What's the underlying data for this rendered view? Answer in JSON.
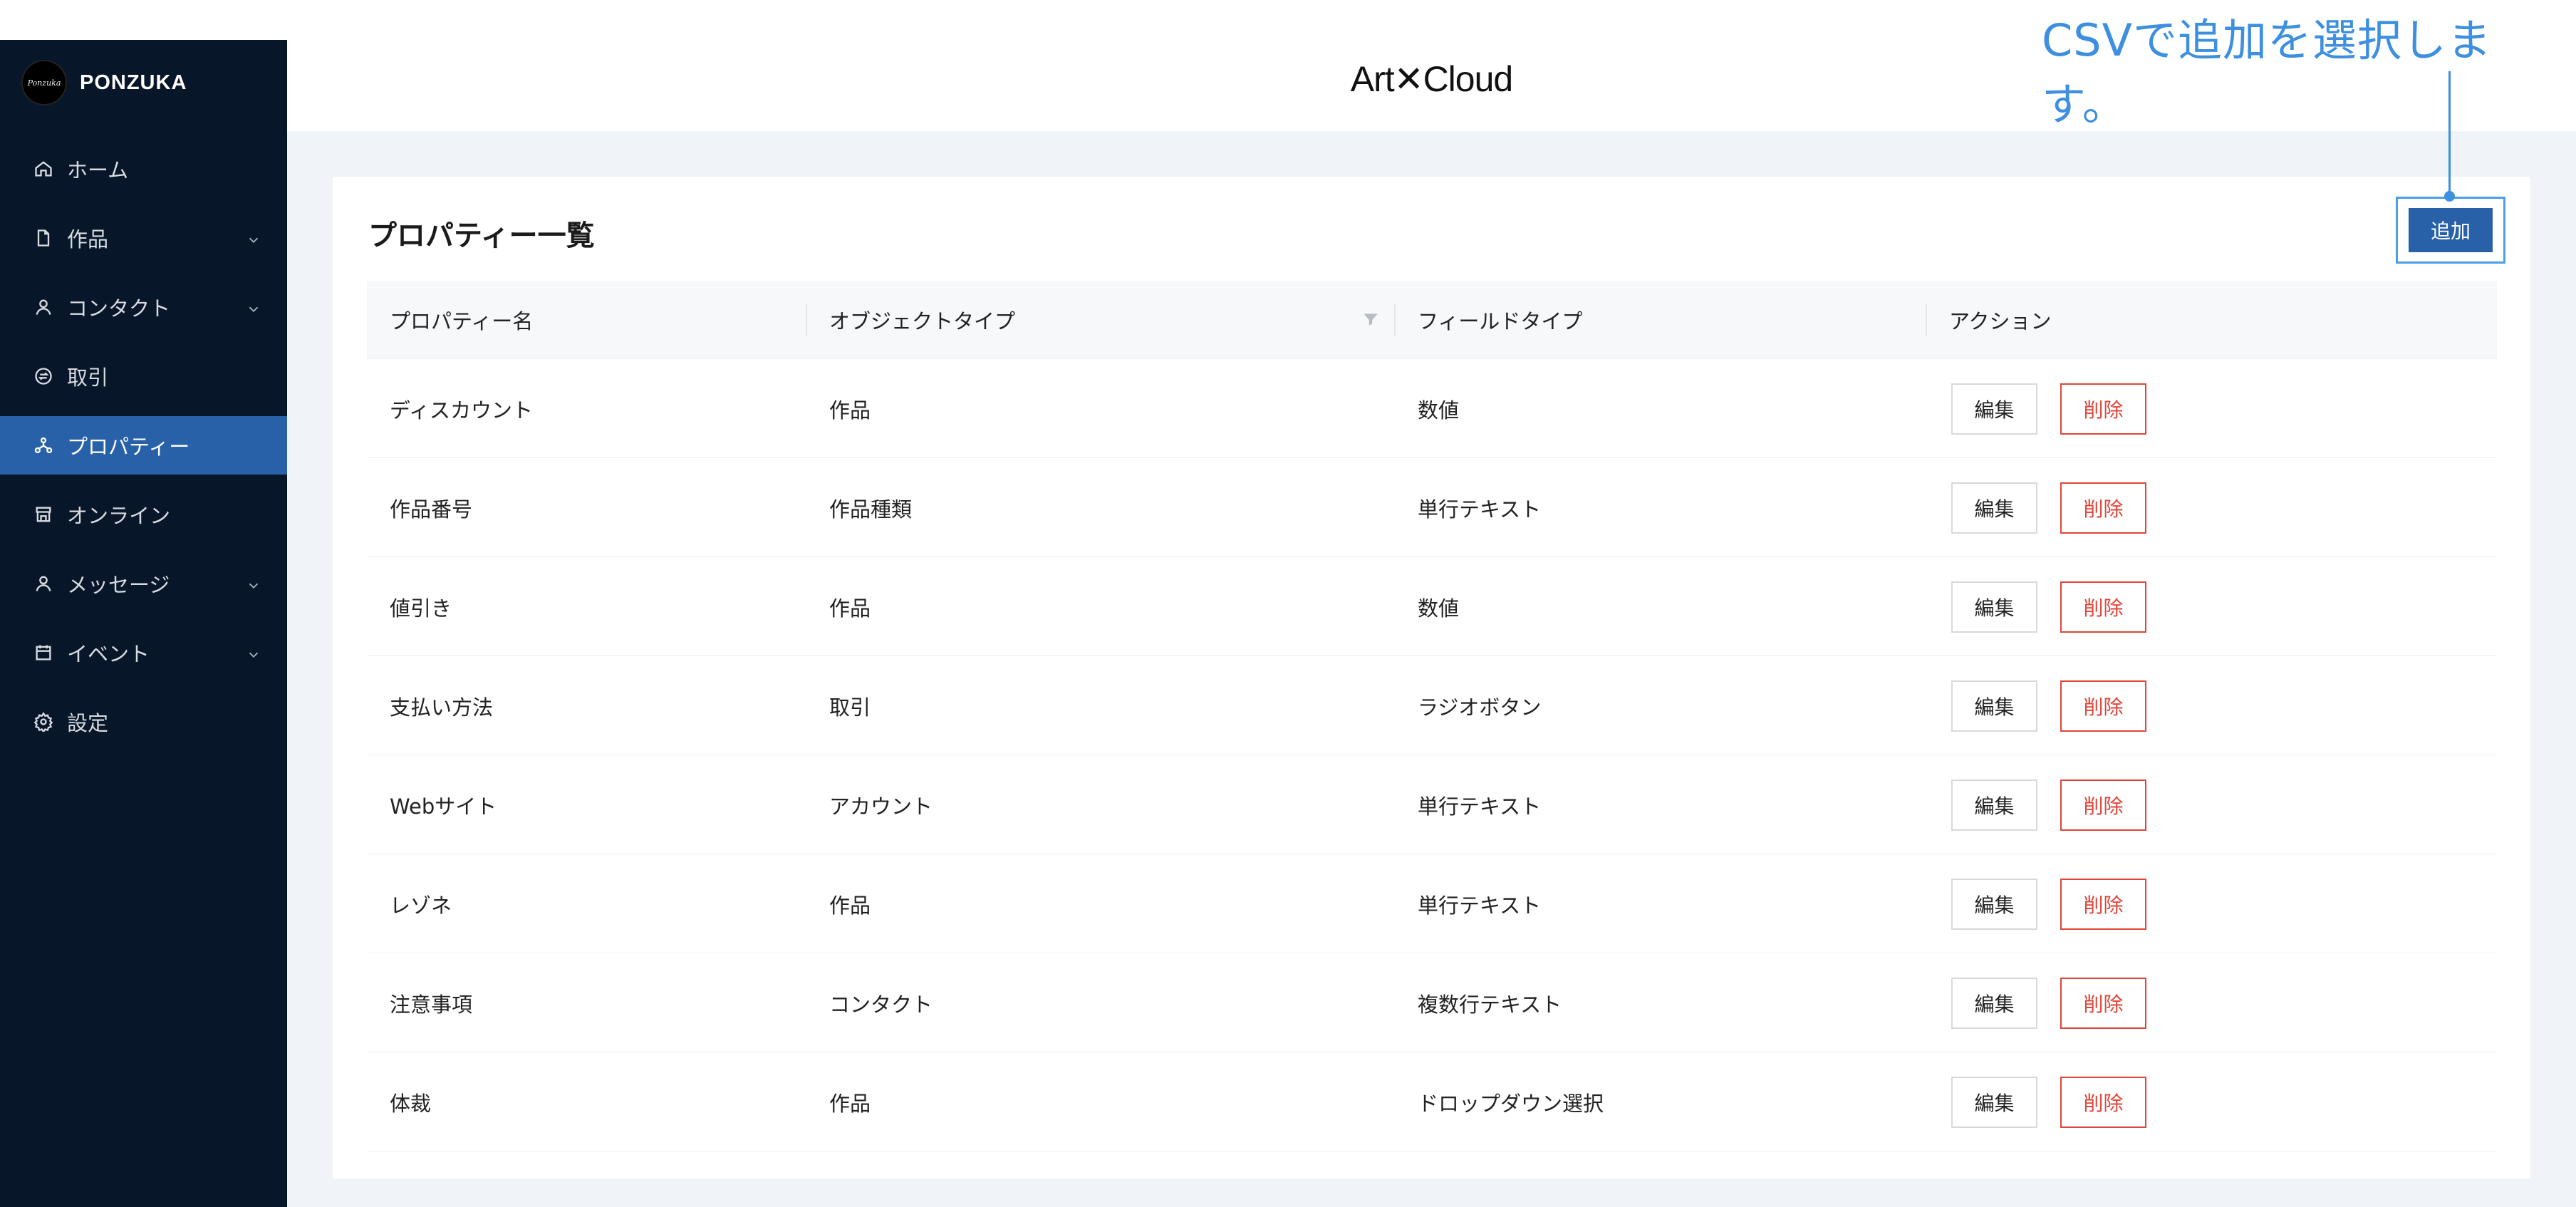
{
  "brand": {
    "logo_text": "Ponzuka",
    "name": "PONZUKA"
  },
  "header": {
    "logo": "Art✕Cloud"
  },
  "sidebar": {
    "items": [
      {
        "label": "ホーム",
        "icon": "home-icon",
        "has_chevron": false,
        "active": false
      },
      {
        "label": "作品",
        "icon": "file-icon",
        "has_chevron": true,
        "active": false
      },
      {
        "label": "コンタクト",
        "icon": "user-icon",
        "has_chevron": true,
        "active": false
      },
      {
        "label": "取引",
        "icon": "exchange-icon",
        "has_chevron": false,
        "active": false
      },
      {
        "label": "プロパティー",
        "icon": "network-icon",
        "has_chevron": false,
        "active": true
      },
      {
        "label": "オンライン",
        "icon": "shop-icon",
        "has_chevron": false,
        "active": false
      },
      {
        "label": "メッセージ",
        "icon": "user-icon",
        "has_chevron": true,
        "active": false
      },
      {
        "label": "イベント",
        "icon": "calendar-icon",
        "has_chevron": true,
        "active": false
      },
      {
        "label": "設定",
        "icon": "gear-icon",
        "has_chevron": false,
        "active": false
      }
    ]
  },
  "main": {
    "title": "プロパティー一覧",
    "add_label": "追加",
    "callout": "CSVで追加を選択します。"
  },
  "table": {
    "columns": [
      "プロパティー名",
      "オブジェクトタイプ",
      "フィールドタイプ",
      "アクション"
    ],
    "edit_label": "編集",
    "delete_label": "削除",
    "rows": [
      [
        "ディスカウント",
        "作品",
        "数値"
      ],
      [
        "作品番号",
        "作品種類",
        "単行テキスト"
      ],
      [
        "値引き",
        "作品",
        "数値"
      ],
      [
        "支払い方法",
        "取引",
        "ラジオボタン"
      ],
      [
        "Webサイト",
        "アカウント",
        "単行テキスト"
      ],
      [
        "レゾネ",
        "作品",
        "単行テキスト"
      ],
      [
        "注意事項",
        "コンタクト",
        "複数行テキスト"
      ],
      [
        "体裁",
        "作品",
        "ドロップダウン選択"
      ]
    ]
  },
  "colors": {
    "sidebar_bg": "#071729",
    "accent": "#2961a8",
    "danger": "#e0453a",
    "callout": "#3d8fe0"
  }
}
